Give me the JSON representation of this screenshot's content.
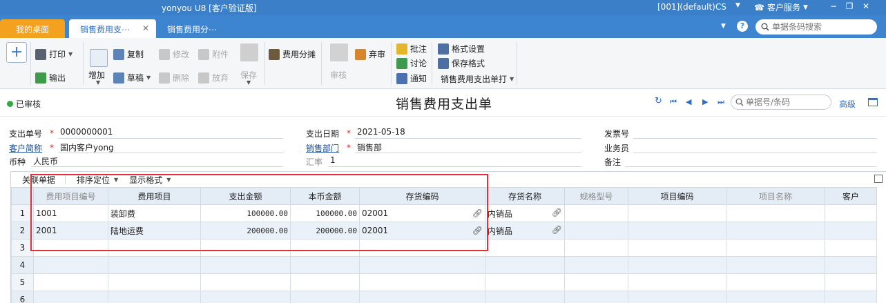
{
  "titlebar": {
    "app_title": "yonyou U8 [客户验证版]",
    "account": "[001](default)CS",
    "service": "客户服务"
  },
  "tabs": {
    "home": "我的桌面",
    "active": "销售费用支⋯",
    "other": "销售费用分⋯",
    "search_placeholder": "单据条码搜索"
  },
  "ribbon": {
    "print": "打印",
    "export": "输出",
    "add": "增加",
    "copy": "复制",
    "draft": "草稿",
    "modify": "修改",
    "delete": "删除",
    "attach": "附件",
    "abandon": "放弃",
    "save": "保存",
    "split": "费用分摊",
    "audit": "审核",
    "unaudit": "弃审",
    "annotate": "批注",
    "discuss": "讨论",
    "notify": "通知",
    "format_settings": "格式设置",
    "save_format": "保存格式",
    "print_template": "销售费用支出单打"
  },
  "header": {
    "status": "已审核",
    "title": "销售费用支出单",
    "search_placeholder": "单据号/条码",
    "advanced": "高级"
  },
  "form": {
    "doc_no_label": "支出单号",
    "doc_no": "0000000001",
    "date_label": "支出日期",
    "date": "2021-05-18",
    "invoice_label": "发票号",
    "invoice": "",
    "customer_label": "客户简称",
    "customer": "国内客户yong",
    "dept_label": "销售部门",
    "dept": "销售部",
    "salesman_label": "业务员",
    "salesman": "",
    "currency_label": "币种",
    "currency": "人民币",
    "rate_label": "汇率",
    "rate": "1",
    "remark_label": "备注",
    "remark": ""
  },
  "grid": {
    "tools": {
      "link": "关联单据",
      "sort": "排序定位",
      "display": "显示格式"
    },
    "columns": [
      "费用项目编号",
      "费用项目",
      "支出金额",
      "本币金额",
      "存货编码",
      "存货名称",
      "规格型号",
      "项目编码",
      "项目名称",
      "客户"
    ],
    "rows": [
      {
        "no": "1",
        "item_code": "1001",
        "item": "装卸费",
        "amount": "100000.00",
        "local_amount": "100000.00",
        "inv_code": "02001",
        "inv_name": "内销品"
      },
      {
        "no": "2",
        "item_code": "2001",
        "item": "陆地运费",
        "amount": "200000.00",
        "local_amount": "200000.00",
        "inv_code": "02001",
        "inv_name": "内销品"
      },
      {
        "no": "3"
      },
      {
        "no": "4"
      },
      {
        "no": "5"
      },
      {
        "no": "6"
      }
    ]
  },
  "colors": {
    "accent": "#3d84d1",
    "home_tab": "#f3a11f",
    "highlight": "#e0303a"
  }
}
